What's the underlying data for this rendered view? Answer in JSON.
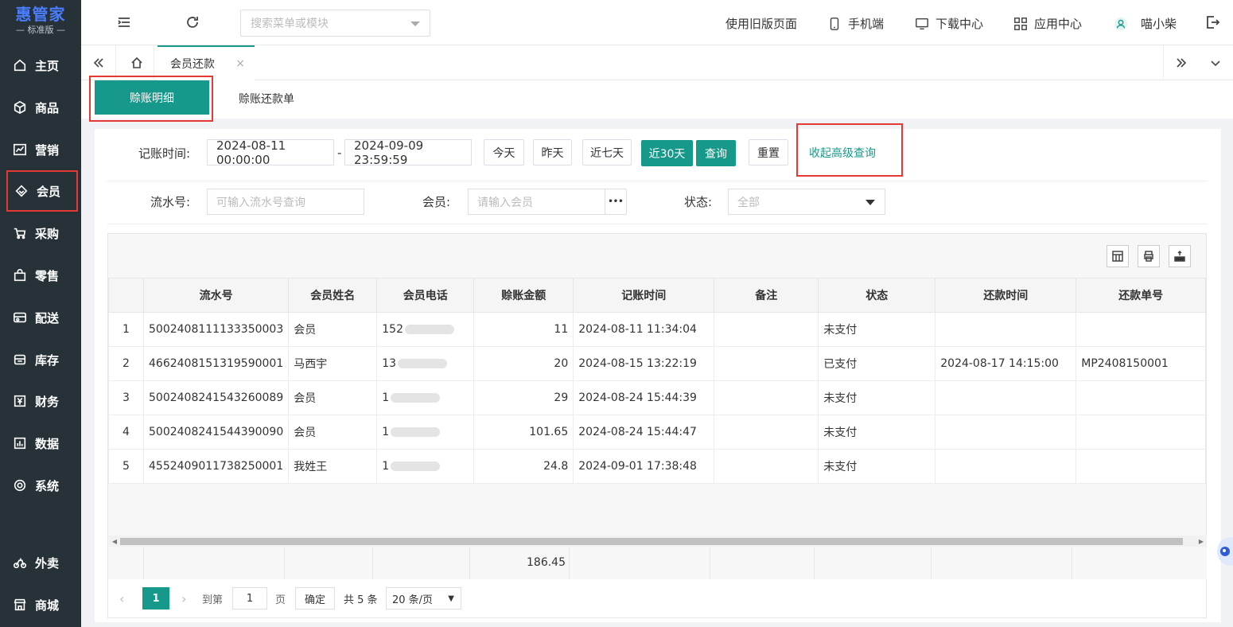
{
  "logo": {
    "title": "惠管家",
    "subtitle": "— 标准版 —"
  },
  "sidebar": {
    "items": [
      {
        "label": "主页",
        "icon": "home-icon"
      },
      {
        "label": "商品",
        "icon": "box-icon"
      },
      {
        "label": "营销",
        "icon": "chart-icon"
      },
      {
        "label": "会员",
        "icon": "diamond-icon",
        "active": true
      },
      {
        "label": "采购",
        "icon": "cart-icon"
      },
      {
        "label": "零售",
        "icon": "bag-icon"
      },
      {
        "label": "配送",
        "icon": "truck-icon"
      },
      {
        "label": "库存",
        "icon": "warehouse-icon"
      },
      {
        "label": "财务",
        "icon": "yen-icon"
      },
      {
        "label": "数据",
        "icon": "bar-chart-icon"
      },
      {
        "label": "系统",
        "icon": "settings-icon"
      },
      {
        "label": "外卖",
        "icon": "delivery-icon"
      },
      {
        "label": "商城",
        "icon": "store-icon"
      }
    ]
  },
  "topbar": {
    "search_placeholder": "搜索菜单或模块",
    "old_page": "使用旧版页面",
    "mobile": "手机端",
    "download": "下载中心",
    "apps": "应用中心",
    "user": "喵小柴"
  },
  "tabs": {
    "active": "会员还款",
    "close": "×"
  },
  "subtabs": {
    "detail": "赊账明细",
    "repay": "赊账还款单"
  },
  "filter": {
    "time_label": "记账时间:",
    "start": "2024-08-11 00:00:00",
    "sep": "-",
    "end": "2024-09-09 23:59:59",
    "today": "今天",
    "yesterday": "昨天",
    "week": "近七天",
    "month": "近30天",
    "query": "查询",
    "reset": "重置",
    "collapse": "收起高级查询",
    "serial_label": "流水号:",
    "serial_placeholder": "可输入流水号查询",
    "member_label": "会员:",
    "member_placeholder": "请输入会员",
    "more": "•••",
    "status_label": "状态:",
    "status_value": "全部"
  },
  "table": {
    "headers": [
      "",
      "流水号",
      "会员姓名",
      "会员电话",
      "赊账金额",
      "记账时间",
      "备注",
      "状态",
      "还款时间",
      "还款单号"
    ],
    "rows": [
      {
        "idx": "1",
        "serial": "5002408111133350003",
        "name": "会员",
        "phone": "152",
        "amount": "11",
        "time": "2024-08-11 11:34:04",
        "note": "",
        "status": "未支付",
        "repay_time": "",
        "repay_no": ""
      },
      {
        "idx": "2",
        "serial": "4662408151319590001",
        "name": "马西宇",
        "phone": "13",
        "amount": "20",
        "time": "2024-08-15 13:22:19",
        "note": "",
        "status": "已支付",
        "repay_time": "2024-08-17 14:15:00",
        "repay_no": "MP2408150001"
      },
      {
        "idx": "3",
        "serial": "5002408241543260089",
        "name": "会员",
        "phone": "1",
        "amount": "29",
        "time": "2024-08-24 15:44:39",
        "note": "",
        "status": "未支付",
        "repay_time": "",
        "repay_no": ""
      },
      {
        "idx": "4",
        "serial": "5002408241544390090",
        "name": "会员",
        "phone": "1",
        "amount": "101.65",
        "time": "2024-08-24 15:44:47",
        "note": "",
        "status": "未支付",
        "repay_time": "",
        "repay_no": ""
      },
      {
        "idx": "5",
        "serial": "4552409011738250001",
        "name": "我姓王",
        "phone": "1",
        "amount": "24.8",
        "time": "2024-09-01 17:38:48",
        "note": "",
        "status": "未支付",
        "repay_time": "",
        "repay_no": ""
      }
    ],
    "total_amount": "186.45"
  },
  "pager": {
    "current": "1",
    "goto_label": "到第",
    "goto_value": "1",
    "page_label": "页",
    "confirm": "确定",
    "total": "共 5 条",
    "page_size": "20 条/页"
  },
  "colors": {
    "accent": "#16998a",
    "sidebar": "#263238",
    "highlight": "#e53935"
  }
}
